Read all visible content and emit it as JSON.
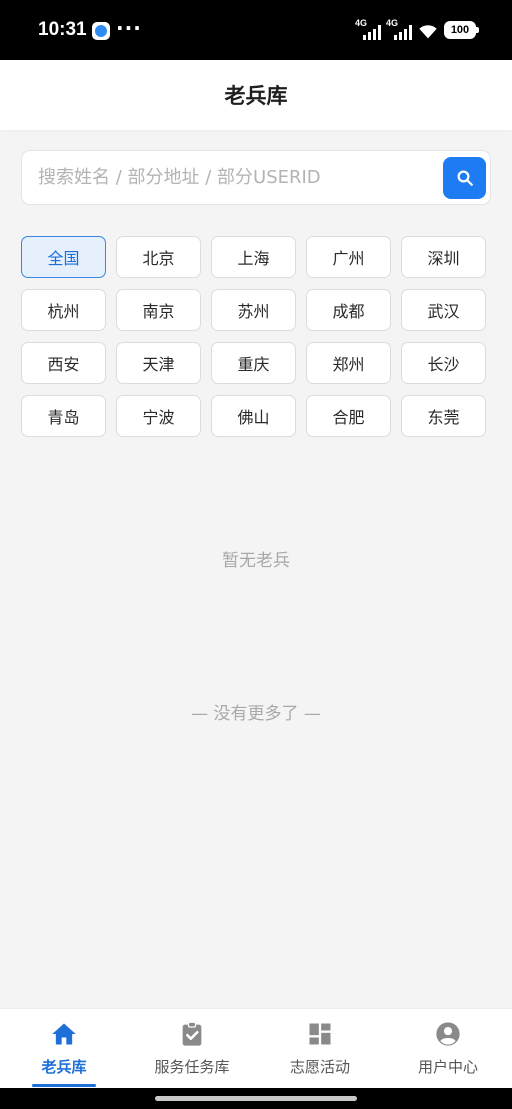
{
  "status_bar": {
    "time": "10:31",
    "dots": "···",
    "network_1": "4G",
    "network_2": "4G",
    "battery": "100"
  },
  "header": {
    "title": "老兵库"
  },
  "search": {
    "placeholder": "搜索姓名 / 部分地址 / 部分USERID",
    "value": ""
  },
  "cities": [
    {
      "label": "全国",
      "active": true
    },
    {
      "label": "北京"
    },
    {
      "label": "上海"
    },
    {
      "label": "广州"
    },
    {
      "label": "深圳"
    },
    {
      "label": "杭州"
    },
    {
      "label": "南京"
    },
    {
      "label": "苏州"
    },
    {
      "label": "成都"
    },
    {
      "label": "武汉"
    },
    {
      "label": "西安"
    },
    {
      "label": "天津"
    },
    {
      "label": "重庆"
    },
    {
      "label": "郑州"
    },
    {
      "label": "长沙"
    },
    {
      "label": "青岛"
    },
    {
      "label": "宁波"
    },
    {
      "label": "佛山"
    },
    {
      "label": "合肥"
    },
    {
      "label": "东莞"
    }
  ],
  "content": {
    "empty_text": "暂无老兵",
    "end_text": "— 没有更多了 —"
  },
  "tabs": [
    {
      "label": "老兵库",
      "icon": "home-icon",
      "active": true
    },
    {
      "label": "服务任务库",
      "icon": "clipboard-check-icon"
    },
    {
      "label": "志愿活动",
      "icon": "dashboard-icon"
    },
    {
      "label": "用户中心",
      "icon": "user-circle-icon"
    }
  ],
  "colors": {
    "accent": "#1e7cf2",
    "active_chip_bg": "#e5f0fc",
    "tab_active": "#1e6fd8",
    "tab_inactive_icon": "#8a8a8c"
  }
}
